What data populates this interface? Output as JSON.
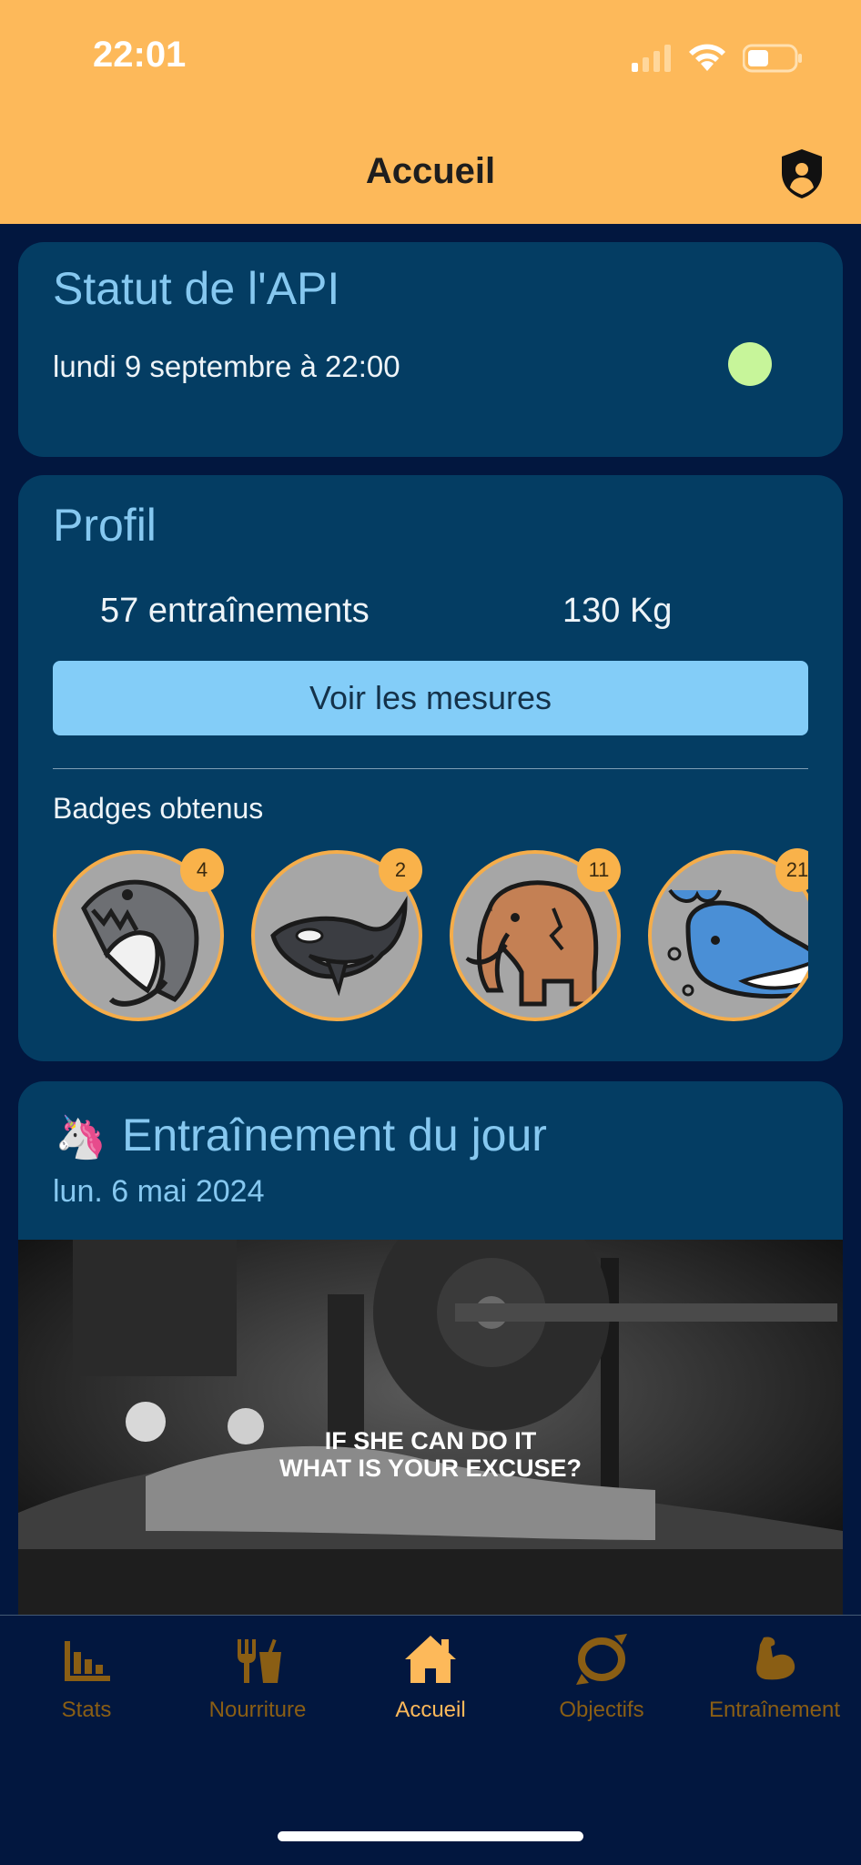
{
  "status_bar": {
    "time": "22:01"
  },
  "nav": {
    "title": "Accueil"
  },
  "api_card": {
    "title": "Statut de l'API",
    "date": "lundi 9 septembre à 22:00",
    "status_color": "#c7f59a"
  },
  "profile_card": {
    "title": "Profil",
    "workouts": "57 entraînements",
    "weight": "130 Kg",
    "measures_button": "Voir les mesures",
    "badges_title": "Badges obtenus",
    "badges": [
      {
        "icon": "shark-icon",
        "count": "4"
      },
      {
        "icon": "orca-icon",
        "count": "2"
      },
      {
        "icon": "mammoth-icon",
        "count": "11"
      },
      {
        "icon": "whale-icon",
        "count": "21"
      }
    ]
  },
  "workout_card": {
    "emoji": "🦄",
    "title": "Entraînement du jour",
    "date": "lun. 6 mai 2024",
    "image_caption_line1": "IF SHE CAN DO IT",
    "image_caption_line2": "WHAT IS YOUR EXCUSE?"
  },
  "tabbar": {
    "tabs": [
      {
        "label": "Stats",
        "icon": "bar-chart-icon"
      },
      {
        "label": "Nourriture",
        "icon": "fork-cup-icon"
      },
      {
        "label": "Accueil",
        "icon": "home-icon",
        "active": true
      },
      {
        "label": "Objectifs",
        "icon": "target-ring-icon"
      },
      {
        "label": "Entraînement",
        "icon": "bicep-icon"
      }
    ]
  },
  "colors": {
    "accent": "#fdb95a",
    "card": "#043d63",
    "background": "#02173f",
    "title_blue": "#86c8f0",
    "button": "#83cdf8"
  }
}
